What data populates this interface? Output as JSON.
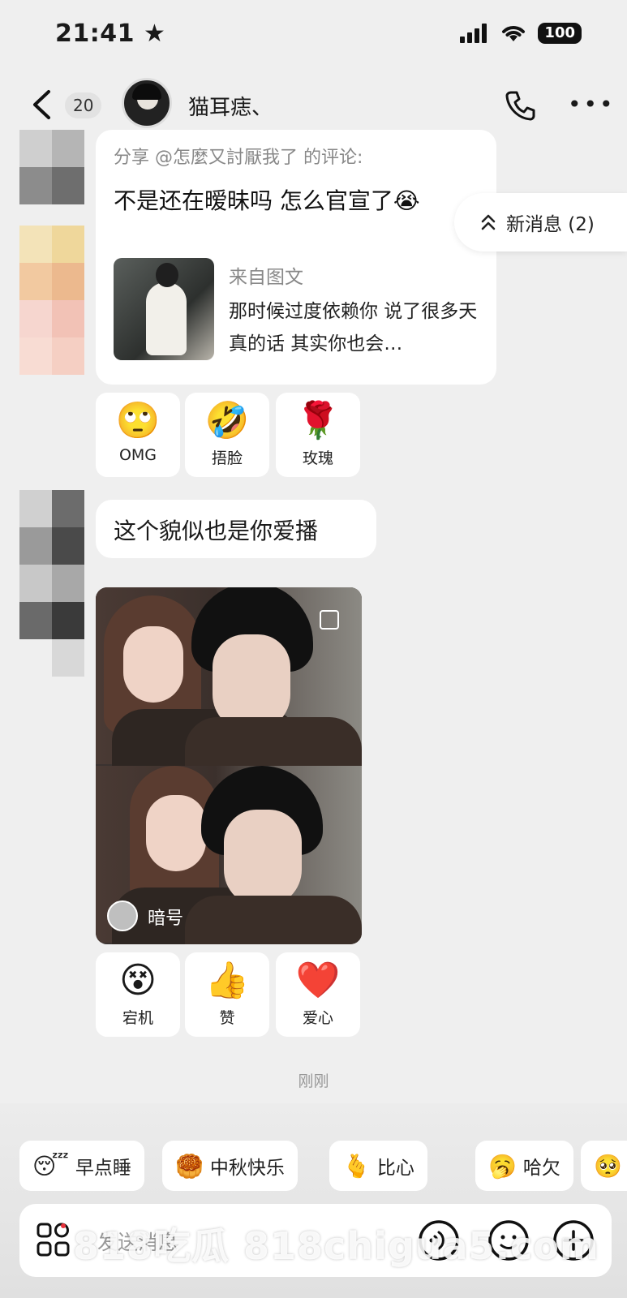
{
  "status_bar": {
    "time": "21:41",
    "battery": "100"
  },
  "header": {
    "unread_count": "20",
    "contact_name": "猫耳痣、"
  },
  "messages": {
    "share": {
      "title": "分享 @怎麼又討厭我了 的评论:",
      "comment": "不是还在暧昧吗 怎么官宣了😭",
      "from_label": "来自图文",
      "snippet": "那时候过度依赖你 说了很多天真的话 其实你也会…"
    },
    "reactions_1": [
      {
        "emoji": "🙄",
        "label": "OMG"
      },
      {
        "emoji": "🤣",
        "label": "捂脸"
      },
      {
        "emoji": "🌹",
        "label": "玫瑰"
      }
    ],
    "text": "这个貌似也是你爱播",
    "photo_code_label": "暗号",
    "reactions_2": [
      {
        "emoji": "😵",
        "label": "宕机"
      },
      {
        "emoji": "👍",
        "label": "赞"
      },
      {
        "emoji": "❤️",
        "label": "爱心"
      }
    ],
    "timestamp": "刚刚"
  },
  "new_messages_label": "新消息 (2)",
  "quick_replies": [
    {
      "emoji": "😴",
      "label": "早点睡"
    },
    {
      "emoji": "🥮",
      "label": "中秋快乐"
    },
    {
      "emoji": "🫰",
      "label": "比心"
    },
    {
      "emoji": "🥱",
      "label": "哈欠"
    },
    {
      "emoji": "🥺",
      "label": ""
    }
  ],
  "input": {
    "placeholder": "发送消息"
  },
  "watermark": "818吃瓜  818chigua5.com",
  "colors": {
    "background": "#efefef",
    "bubble": "#ffffff",
    "accent_heart": "#e8323c"
  }
}
